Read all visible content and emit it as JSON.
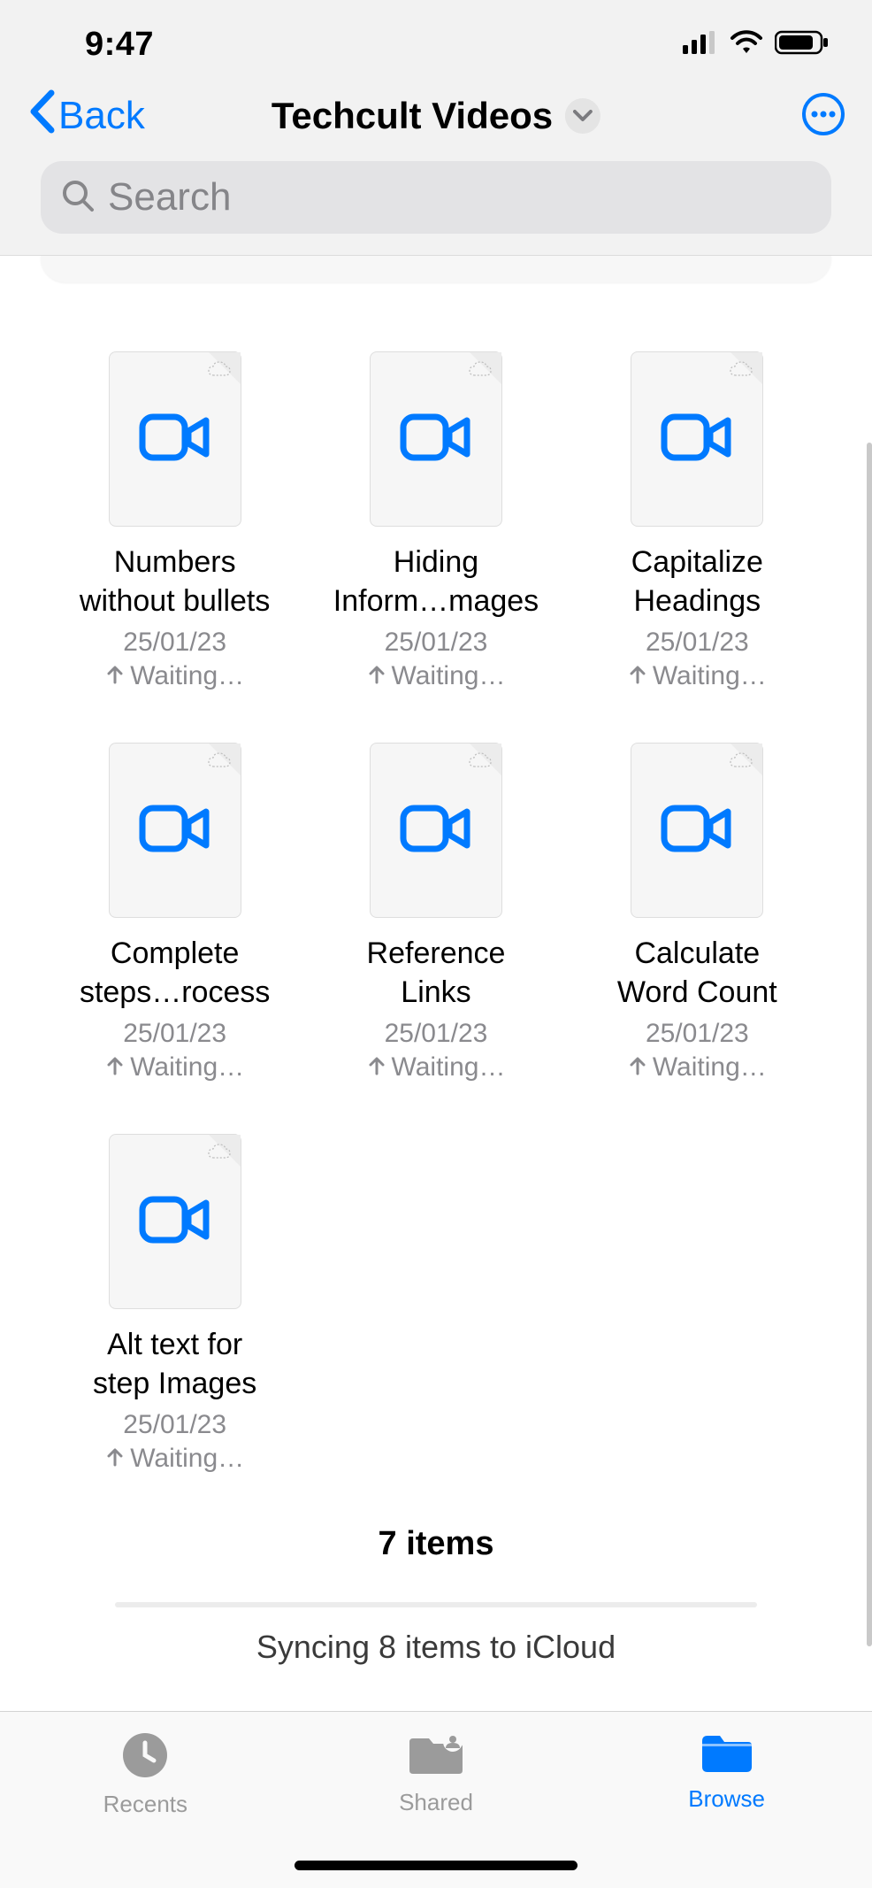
{
  "status": {
    "time": "9:47"
  },
  "nav": {
    "back_label": "Back",
    "title": "Techcult Videos"
  },
  "search": {
    "placeholder": "Search"
  },
  "files": [
    {
      "line1": "Numbers",
      "line2": "without bullets",
      "date": "25/01/23",
      "status": "Waiting…"
    },
    {
      "line1": "Hiding",
      "line2": "Inform…mages",
      "date": "25/01/23",
      "status": "Waiting…"
    },
    {
      "line1": "Capitalize",
      "line2": "Headings",
      "date": "25/01/23",
      "status": "Waiting…"
    },
    {
      "line1": "Complete",
      "line2": "steps…rocess",
      "date": "25/01/23",
      "status": "Waiting…"
    },
    {
      "line1": "Reference",
      "line2": "Links",
      "date": "25/01/23",
      "status": "Waiting…"
    },
    {
      "line1": "Calculate",
      "line2": "Word Count",
      "date": "25/01/23",
      "status": "Waiting…"
    },
    {
      "line1": "Alt text for",
      "line2": "step Images",
      "date": "25/01/23",
      "status": "Waiting…"
    }
  ],
  "count_label": "7 items",
  "sync_label": "Syncing 8 items to iCloud",
  "tabs": {
    "recents": "Recents",
    "shared": "Shared",
    "browse": "Browse"
  }
}
